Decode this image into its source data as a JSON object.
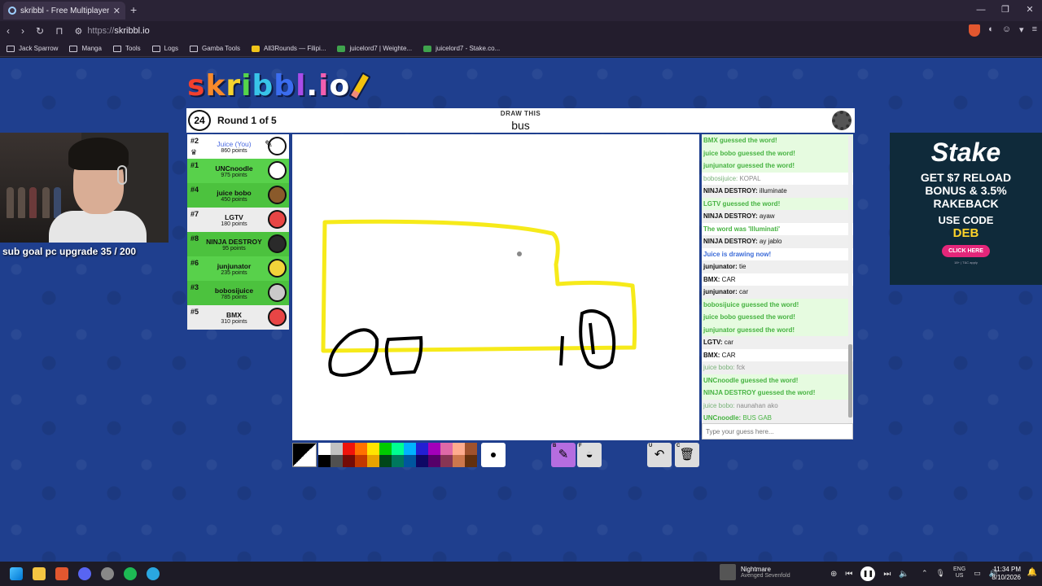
{
  "browser": {
    "tab_title": "skribbl - Free Multiplayer Dra",
    "url_proto": "https://",
    "url_host": "skribbl.io",
    "bookmarks": [
      {
        "label": "Jack Sparrow",
        "icon": "folder-icon"
      },
      {
        "label": "Manga",
        "icon": "folder-icon"
      },
      {
        "label": "Tools",
        "icon": "folder-icon"
      },
      {
        "label": "Logs",
        "icon": "folder-icon"
      },
      {
        "label": "Gamba Tools",
        "icon": "folder-icon"
      },
      {
        "label": "All3Rounds — Filipi...",
        "icon": "site-icon"
      },
      {
        "label": "juicelord7 | Weighte...",
        "icon": "site-icon"
      },
      {
        "label": "juicelord7 - Stake.co...",
        "icon": "site-icon"
      }
    ]
  },
  "game": {
    "logo": [
      "s",
      "k",
      "r",
      "i",
      "b",
      "b",
      "l",
      ".",
      "i",
      "o"
    ],
    "logo_colors": [
      "#f2402e",
      "#f78a2b",
      "#f6d32e",
      "#55d54a",
      "#38c4e8",
      "#3b6df0",
      "#a94ce8",
      "#ffffff",
      "#f25fb0",
      "#ffffff"
    ],
    "timer": "24",
    "round": "Round 1 of 5",
    "draw_label": "DRAW THIS",
    "word": "bus",
    "players": [
      {
        "rank": "#2",
        "name": "Juice (You)",
        "points": "860 points",
        "style": "white",
        "avatar": "#ffffff",
        "me": true
      },
      {
        "rank": "#1",
        "name": "UNCnoodle",
        "points": "975 points",
        "style": "guessed",
        "avatar": "#ffffff"
      },
      {
        "rank": "#4",
        "name": "juice bobo",
        "points": "450 points",
        "style": "guessed",
        "avatar": "#8a5a2b"
      },
      {
        "rank": "#7",
        "name": "LGTV",
        "points": "180 points",
        "style": "gray",
        "avatar": "#e84545"
      },
      {
        "rank": "#8",
        "name": "NINJA DESTROY",
        "points": "95 points",
        "style": "guessed",
        "avatar": "#2a2a2a"
      },
      {
        "rank": "#6",
        "name": "junjunator",
        "points": "235 points",
        "style": "guessed",
        "avatar": "#f2d43a"
      },
      {
        "rank": "#3",
        "name": "bobosijuice",
        "points": "785 points",
        "style": "guessed",
        "avatar": "#c9c9c9"
      },
      {
        "rank": "#5",
        "name": "BMX",
        "points": "310 points",
        "style": "gray",
        "avatar": "#e84545"
      }
    ],
    "chat": [
      {
        "type": "g",
        "text": "BMX guessed the word!"
      },
      {
        "type": "g",
        "text": "juice bobo guessed the word!"
      },
      {
        "type": "g",
        "text": "junjunator guessed the word!"
      },
      {
        "type": "dim",
        "name": "bobosijuice:",
        "text": " KOPAL"
      },
      {
        "type": "z",
        "name": "NINJA DESTROY:",
        "text": " illuminate"
      },
      {
        "type": "g",
        "text": "LGTV guessed the word!"
      },
      {
        "type": "z",
        "name": "NINJA DESTROY:",
        "text": " ayaw"
      },
      {
        "type": "g2",
        "text": "The word was 'Illuminati'"
      },
      {
        "type": "z",
        "name": "NINJA DESTROY:",
        "text": " ay jablo"
      },
      {
        "type": "draw",
        "text": "Juice is drawing now!"
      },
      {
        "type": "z",
        "name": "junjunator:",
        "text": " tie"
      },
      {
        "type": "n",
        "name": "BMX:",
        "text": " CAR"
      },
      {
        "type": "z",
        "name": "junjunator:",
        "text": " car"
      },
      {
        "type": "g",
        "text": "bobosijuice guessed the word!"
      },
      {
        "type": "g",
        "text": "juice bobo guessed the word!"
      },
      {
        "type": "g",
        "text": "junjunator guessed the word!"
      },
      {
        "type": "z",
        "name": "LGTV:",
        "text": " car"
      },
      {
        "type": "n",
        "name": "BMX:",
        "text": " CAR"
      },
      {
        "type": "dimz",
        "name": "juice bobo:",
        "text": " fck"
      },
      {
        "type": "g",
        "text": "UNCnoodle guessed the word!"
      },
      {
        "type": "g",
        "text": "NINJA DESTROY guessed the word!"
      },
      {
        "type": "dimz",
        "name": "juice bobo:",
        "text": " naunahan ako"
      },
      {
        "type": "grn",
        "name": "UNCnoodle:",
        "text": " BUS GAB"
      }
    ],
    "guess_placeholder": "Type your guess here...",
    "palette": [
      "#ffffff",
      "#c1c1c1",
      "#ef130b",
      "#ff7100",
      "#ffe400",
      "#00cc00",
      "#00ff91",
      "#00b2ff",
      "#231fd3",
      "#a300ba",
      "#df69a7",
      "#ffac8e",
      "#a0522d",
      "#000000",
      "#505050",
      "#740b07",
      "#c23800",
      "#e8a200",
      "#004619",
      "#00785d",
      "#00569e",
      "#0e0865",
      "#550069",
      "#873554",
      "#cc774d",
      "#63300d"
    ],
    "tools": [
      {
        "key": "B",
        "name": "brush-tool",
        "icon": "pencil-icon",
        "selected": true
      },
      {
        "key": "F",
        "name": "fill-tool",
        "icon": "bucket-icon",
        "selected": false
      },
      {
        "key": "U",
        "name": "undo-tool",
        "icon": "undo-icon",
        "selected": false
      },
      {
        "key": "C",
        "name": "clear-tool",
        "icon": "trash-icon",
        "selected": false
      }
    ]
  },
  "stream": {
    "sub_goal": "sub goal pc upgrade 35 / 200",
    "ad_brand": "Stake",
    "ad_line1": "GET $7 RELOAD",
    "ad_line2": "BONUS & 3.5%",
    "ad_line3": "RAKEBACK",
    "ad_code_label": "USE CODE",
    "ad_code": "DEB",
    "ad_cta": "CLICK HERE",
    "ad_terms": "18+ | T&C apply"
  },
  "taskbar": {
    "song": "Nightmare",
    "artist": "Avenged Sevenfold",
    "lang1": "ENG",
    "lang2": "US",
    "time": "11:34 PM",
    "date": "8/10/2026"
  }
}
